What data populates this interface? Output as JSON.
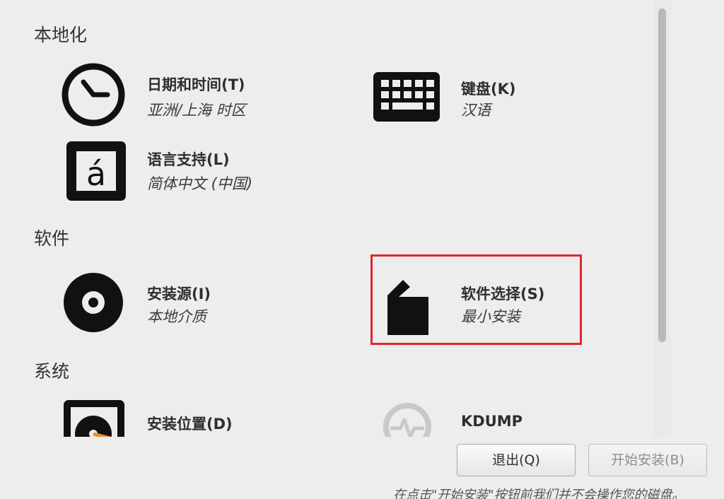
{
  "sections": {
    "localization": "本地化",
    "software": "软件",
    "system": "系统"
  },
  "spokes": {
    "datetime": {
      "title": "日期和时间(T)",
      "status": "亚洲/上海 时区",
      "icon": "clock-icon"
    },
    "keyboard": {
      "title": "键盘(K)",
      "status": "汉语",
      "icon": "keyboard-icon"
    },
    "language": {
      "title": "语言支持(L)",
      "status": "简体中文 (中国)",
      "icon": "language-icon"
    },
    "source": {
      "title": "安装源(I)",
      "status": "本地介质",
      "icon": "disc-icon"
    },
    "software_selection": {
      "title": "软件选择(S)",
      "status": "最小安装",
      "icon": "package-icon"
    },
    "destination": {
      "title": "安装位置(D)",
      "status": "",
      "icon": "harddisk-icon"
    },
    "kdump": {
      "title": "KDUMP",
      "status": "",
      "icon": "kdump-icon"
    }
  },
  "buttons": {
    "quit": "退出(Q)",
    "begin": "开始安装(B)"
  },
  "footer_note": "在点击\"开始安装\"按钮前我们并不会操作您的磁盘。",
  "colors": {
    "highlight": "#e0262e",
    "background": "#ededed"
  }
}
